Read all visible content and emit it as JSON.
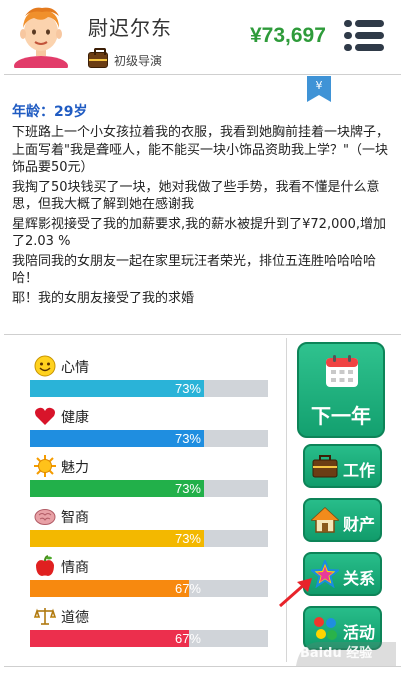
{
  "header": {
    "name": "尉迟尔东",
    "job_title": "初级导演",
    "money": "¥73,697"
  },
  "log": {
    "age": "年龄：29岁",
    "entries": [
      "下班路上一个小女孩拉着我的衣服，我看到她胸前挂着一块牌子，上面写着\"我是聋哑人，能不能买一块小饰品资助我上学？\"（一块饰品要50元）",
      "我掏了50块钱买了一块，她对我做了些手势，我看不懂是什么意思，但我大概了解到她在感谢我",
      "星辉影视接受了我的加薪要求,我的薪水被提升到了¥72,000,增加了2.03 %",
      "我陪同我的女朋友一起在家里玩汪者荣光，排位五连胜哈哈哈哈哈！",
      "耶！我的女朋友接受了我的求婚"
    ]
  },
  "stats": [
    {
      "label": "心情",
      "percent_text": "73%",
      "value": 73,
      "color": "#2ab3d8",
      "icon": "smiley-face-icon"
    },
    {
      "label": "健康",
      "percent_text": "73%",
      "value": 73,
      "color": "#1f8ee0",
      "icon": "heart-icon"
    },
    {
      "label": "魅力",
      "percent_text": "73%",
      "value": 73,
      "color": "#22b04a",
      "icon": "sun-icon"
    },
    {
      "label": "智商",
      "percent_text": "73%",
      "value": 73,
      "color": "#f3b800",
      "icon": "brain-icon"
    },
    {
      "label": "情商",
      "percent_text": "67%",
      "value": 67,
      "color": "#f7890f",
      "icon": "apple-icon"
    },
    {
      "label": "道德",
      "percent_text": "67%",
      "value": 67,
      "color": "#ec2f4d",
      "icon": "scales-icon"
    }
  ],
  "side": {
    "next_year": "下一年",
    "buttons": [
      {
        "label": "工作",
        "icon": "briefcase-icon"
      },
      {
        "label": "财产",
        "icon": "house-icon"
      },
      {
        "label": "关系",
        "icon": "star-icon"
      },
      {
        "label": "活动",
        "icon": "activity-icon"
      }
    ]
  },
  "watermark": "Baidu 经验"
}
